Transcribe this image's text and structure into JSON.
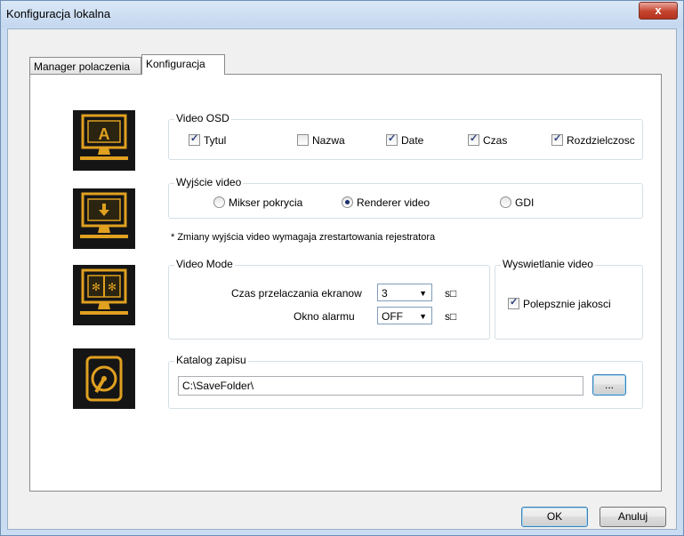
{
  "window": {
    "title": "Konfiguracja lokalna",
    "close": "x"
  },
  "tabs": [
    {
      "label": "Manager polaczenia"
    },
    {
      "label": "Konfiguracja"
    }
  ],
  "osd": {
    "legend": "Video OSD",
    "items": [
      {
        "label": "Tytul",
        "checked": true
      },
      {
        "label": "Nazwa",
        "checked": false
      },
      {
        "label": "Date",
        "checked": true
      },
      {
        "label": "Czas",
        "checked": true
      },
      {
        "label": "Rozdzielczosc",
        "checked": true
      }
    ]
  },
  "video_output": {
    "legend": "Wyjście video",
    "options": [
      {
        "label": "Mikser pokrycia",
        "selected": false
      },
      {
        "label": "Renderer video",
        "selected": true
      },
      {
        "label": "GDI",
        "selected": false
      }
    ],
    "note": "* Zmiany wyjścia video wymagaja zrestartowania rejestratora"
  },
  "video_mode": {
    "legend": "Video Mode",
    "switch_label": "Czas przelaczania ekranow",
    "switch_value": "3",
    "switch_unit": "s",
    "alarm_label": "Okno alarmu",
    "alarm_value": "OFF",
    "alarm_unit": "s"
  },
  "display": {
    "legend": "Wyswietlanie video",
    "quality_label": "Polepsznie jakosci",
    "quality_checked": true
  },
  "record": {
    "legend": "Katalog zapisu",
    "path": "C:\\SaveFolder\\",
    "browse": "..."
  },
  "buttons": {
    "ok": "OK",
    "cancel": "Anuluj"
  },
  "icons": {
    "osd": "monitor-letter-a-icon",
    "output": "monitor-download-icon",
    "mode": "monitor-split-icon",
    "storage": "hard-disk-icon",
    "accent": "#e0a020"
  }
}
